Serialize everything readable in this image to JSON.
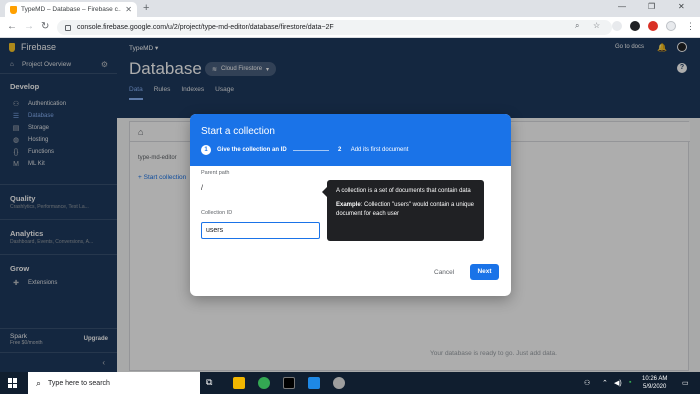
{
  "browser": {
    "tab_title": "TypeMD – Database – Firebase c…",
    "url": "console.firebase.google.com/u/2/project/type-md-editor/database/firestore/data~2F"
  },
  "sidebar": {
    "brand": "Firebase",
    "overview": "Project Overview",
    "develop_title": "Develop",
    "items": [
      {
        "label": "Authentication",
        "icon": "people-icon"
      },
      {
        "label": "Database",
        "icon": "database-icon"
      },
      {
        "label": "Storage",
        "icon": "storage-icon"
      },
      {
        "label": "Hosting",
        "icon": "globe-icon"
      },
      {
        "label": "Functions",
        "icon": "functions-icon"
      },
      {
        "label": "ML Kit",
        "icon": "mlkit-icon"
      }
    ],
    "quality_title": "Quality",
    "quality_sub": "Crashlytics, Performance, Test La...",
    "analytics_title": "Analytics",
    "analytics_sub": "Dashboard, Events, Conversions, A...",
    "grow_title": "Grow",
    "extensions": "Extensions",
    "plan_name": "Spark",
    "plan_sub": "Free $0/month",
    "upgrade": "Upgrade"
  },
  "header": {
    "project": "TypeMD ▾",
    "go_to_docs": "Go to docs",
    "title": "Database",
    "db_chip": "Cloud Firestore",
    "tabs": [
      "Data",
      "Rules",
      "Indexes",
      "Usage"
    ]
  },
  "panel": {
    "collection_path": "type-md-editor",
    "start_collection": "Start collection",
    "empty_message": "Your database is ready to go. Just add data."
  },
  "dialog": {
    "title": "Start a collection",
    "step1_num": "1",
    "step1_label": "Give the collection an ID",
    "step2_num": "2",
    "step2_label": "Add its first document",
    "parent_path_label": "Parent path",
    "parent_path_value": "/",
    "collection_id_label": "Collection ID",
    "collection_id_value": "users",
    "cancel": "Cancel",
    "next": "Next"
  },
  "tooltip": {
    "line1": "A collection is a set of documents that contain data",
    "example_label": "Example",
    "example_text": ": Collection \"users\" would contain a unique document for each user"
  },
  "taskbar": {
    "search_placeholder": "Type here to search",
    "time": "10:26 AM",
    "date": "5/9/2020"
  },
  "colors": {
    "firebase_navy": "#1e3a5f",
    "accent_blue": "#1a73e8",
    "tooltip_bg": "#202124"
  }
}
